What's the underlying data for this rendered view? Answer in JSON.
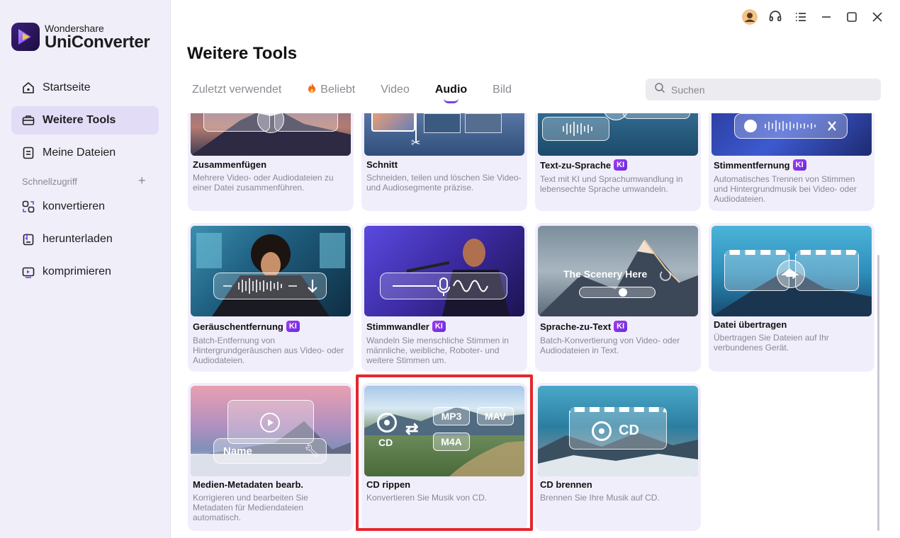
{
  "app": {
    "brand_small": "Wondershare",
    "brand_large": "UniConverter"
  },
  "sidebar": {
    "items": [
      {
        "label": "Startseite",
        "icon": "home-icon"
      },
      {
        "label": "Weitere Tools",
        "icon": "toolbox-icon",
        "active": true
      },
      {
        "label": "Meine Dateien",
        "icon": "file-icon"
      }
    ],
    "quick_access_label": "Schnellzugriff",
    "quick_items": [
      {
        "label": "konvertieren",
        "icon": "convert-icon"
      },
      {
        "label": "herunterladen",
        "icon": "download-icon"
      },
      {
        "label": "komprimieren",
        "icon": "compress-icon"
      }
    ]
  },
  "header": {
    "title": "Weitere Tools"
  },
  "tabs": [
    {
      "label": "Zuletzt verwendet"
    },
    {
      "label": "Beliebt",
      "icon": "fire-icon"
    },
    {
      "label": "Video"
    },
    {
      "label": "Audio",
      "active": true
    },
    {
      "label": "Bild"
    }
  ],
  "search": {
    "placeholder": "Suchen"
  },
  "badge_label": "KI",
  "cards": [
    {
      "title": "Zusammenfügen",
      "desc": "Mehrere Video- oder Audiodateien zu einer Datei zusammenführen."
    },
    {
      "title": "Schnitt",
      "desc": "Schneiden, teilen und löschen Sie Video- und Audiosegmente präzise."
    },
    {
      "title": "Text-zu-Sprache",
      "ki": true,
      "desc": "Text mit KI und Sprachumwandlung in lebensechte Sprache umwandeln."
    },
    {
      "title": "Stimmentfernung",
      "ki": true,
      "desc": "Automatisches Trennen von Stimmen und Hintergrundmusik bei Video- oder Audiodateien."
    },
    {
      "title": "Geräuschentfernung",
      "ki": true,
      "desc": "Batch-Entfernung von Hintergrundgeräuschen aus Video- oder Audiodateien."
    },
    {
      "title": "Stimmwandler",
      "ki": true,
      "desc": "Wandeln Sie menschliche Stimmen in männliche, weibliche, Roboter- und weitere Stimmen um."
    },
    {
      "title": "Sprache-zu-Text",
      "ki": true,
      "desc": "Batch-Konvertierung von Video- oder Audiodateien in Text.",
      "thumb_text": "The Scenery Here"
    },
    {
      "title": "Datei übertragen",
      "desc": "Übertragen Sie Dateien auf Ihr verbundenes Gerät."
    },
    {
      "title": "Medien-Metadaten bearb.",
      "desc": "Korrigieren und bearbeiten Sie Metadaten für Mediendateien automatisch.",
      "thumb_text": "Name"
    },
    {
      "title": "CD rippen",
      "desc": "Konvertieren Sie Musik von CD.",
      "thumb_labels": [
        "MP3",
        "MAV",
        "M4A",
        "CD"
      ],
      "highlighted": true
    },
    {
      "title": "CD brennen",
      "desc": "Brennen Sie Ihre Musik auf CD.",
      "thumb_text": "CD"
    }
  ],
  "colors": {
    "accent": "#7b3fe4",
    "highlight": "#e6262e",
    "card_bg": "#f1eefc",
    "sidebar_active": "#e2dcf6"
  }
}
